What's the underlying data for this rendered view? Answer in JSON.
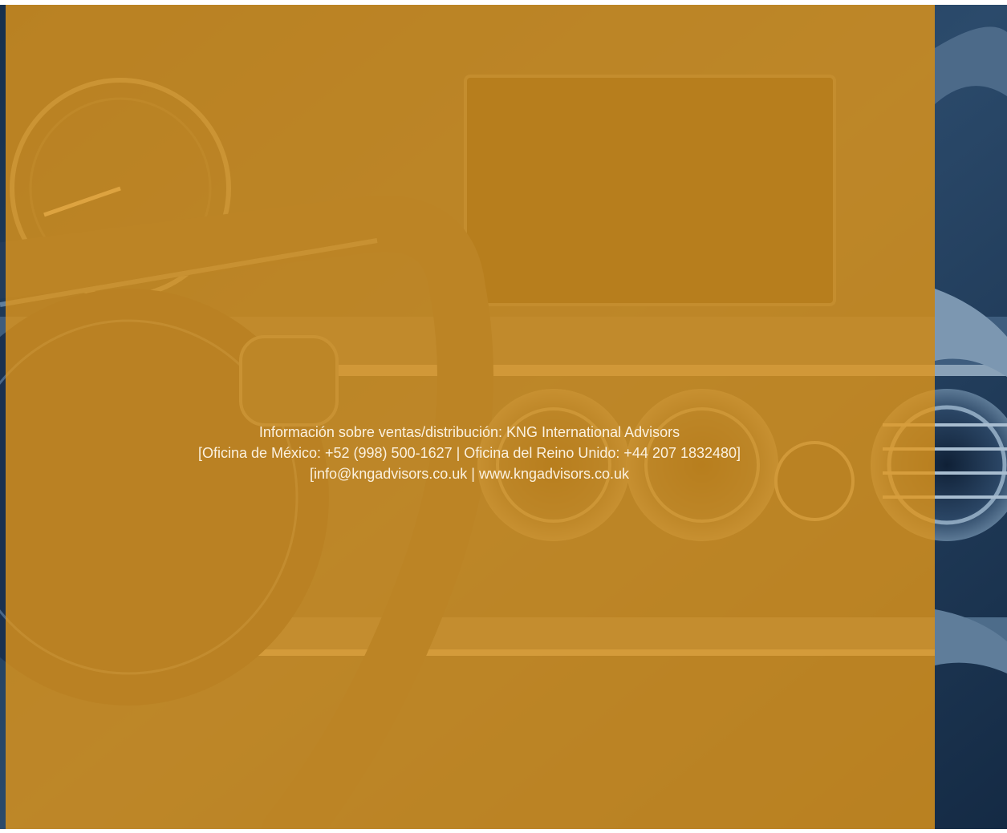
{
  "colors": {
    "panel_orange": "#e29618",
    "background_navy": "#1f3550",
    "text": "#fbf1df"
  },
  "background_image": "car-dashboard-steering-wheel",
  "contact": {
    "line1": "Información sobre ventas/distribución: KNG International Advisors",
    "line2": "[Oficina de México: +52 (998) 500-1627 | Oficina del Reino Unido: +44 207 1832480]",
    "line3": "[info@kngadvisors.co.uk | www.kngadvisors.co.uk"
  }
}
